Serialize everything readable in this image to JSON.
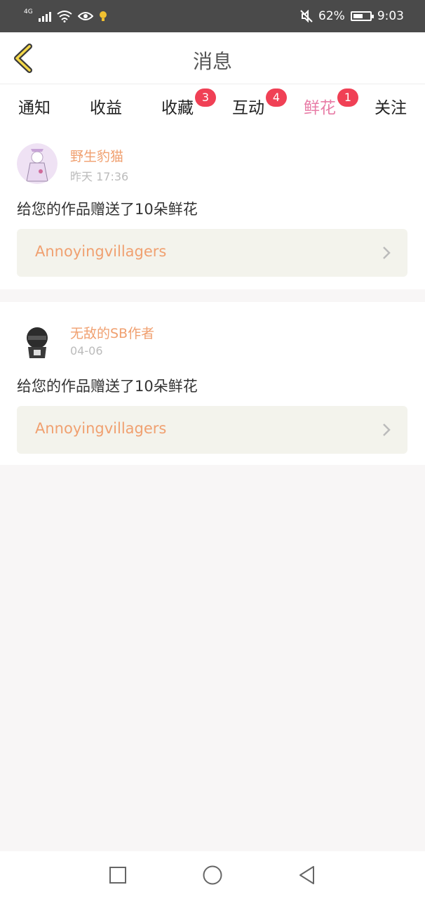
{
  "status": {
    "network": "4G",
    "battery_pct": "62%",
    "battery_level": 0.62,
    "clock": "9:03"
  },
  "header": {
    "title": "消息"
  },
  "tabs": [
    {
      "label": "通知",
      "badge": ""
    },
    {
      "label": "收益",
      "badge": ""
    },
    {
      "label": "收藏",
      "badge": "3"
    },
    {
      "label": "互动",
      "badge": "4"
    },
    {
      "label": "鲜花",
      "badge": "1"
    },
    {
      "label": "关注",
      "badge": ""
    }
  ],
  "active_tab": "鲜花",
  "messages": [
    {
      "user": "野生豹猫",
      "time": "昨天 17:36",
      "text": "给您的作品赠送了10朵鲜花",
      "work": "Annoyingvillagers"
    },
    {
      "user": "无敌的SB作者",
      "time": "04-06",
      "text": "给您的作品赠送了10朵鲜花",
      "work": "Annoyingvillagers"
    }
  ],
  "colors": {
    "accent": "#e87ca6",
    "orange_text": "#f0a070",
    "badge": "#f04055"
  }
}
